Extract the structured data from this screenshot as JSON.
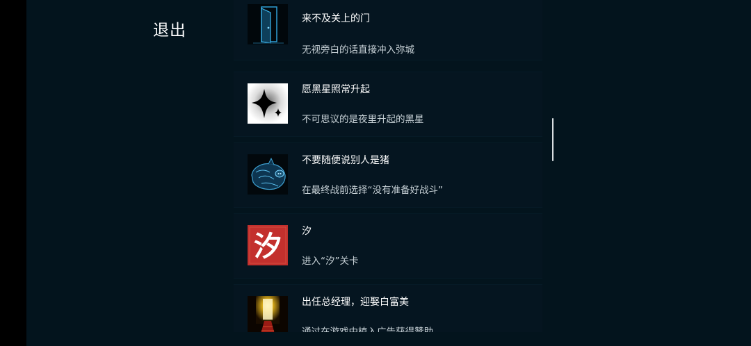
{
  "header": {
    "exit_label": "退出"
  },
  "achievements": [
    {
      "title": "来不及关上的门",
      "desc": "无视旁白的话直接冲入弥城",
      "icon": "door-icon"
    },
    {
      "title": "愿黑星照常升起",
      "desc": "不可思议的是夜里升起的黑星",
      "icon": "black-star-icon"
    },
    {
      "title": "不要随便说别人是猪",
      "desc": "在最终战前选择“没有准备好战斗”",
      "icon": "pig-icon"
    },
    {
      "title": "汐",
      "desc": "进入“汐”关卡",
      "icon": "xi-character-icon",
      "icon_text": "汐"
    },
    {
      "title": "出任总经理，迎娶白富美",
      "desc": "通过在游戏中植入广告获得赞助",
      "icon": "golden-corridor-icon"
    }
  ],
  "colors": {
    "background": "#03141d",
    "card": "#051520",
    "accent_blue": "#2f9fd6",
    "xi_red": "#c3302d"
  }
}
